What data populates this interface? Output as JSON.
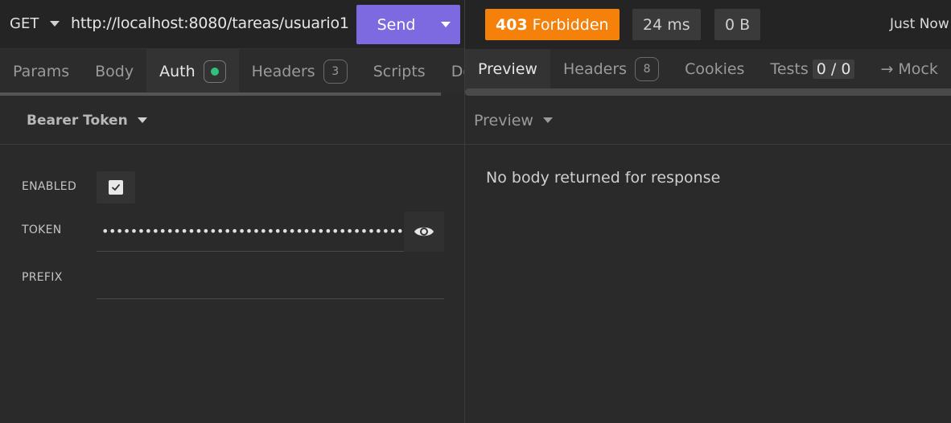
{
  "request": {
    "method": "GET",
    "url": "http://localhost:8080/tareas/usuario1",
    "send_label": "Send"
  },
  "request_tabs": [
    {
      "label": "Params"
    },
    {
      "label": "Body"
    },
    {
      "label": "Auth"
    },
    {
      "label": "Headers",
      "count": "3"
    },
    {
      "label": "Scripts"
    },
    {
      "label": "Docs"
    }
  ],
  "auth": {
    "type_label": "Bearer Token",
    "enabled_label": "ENABLED",
    "enabled": true,
    "token_label": "TOKEN",
    "token_masked": "••••••••••••••••••••••••••••••••••••••••••••••••••",
    "prefix_label": "PREFIX",
    "prefix_value": ""
  },
  "response": {
    "status_code": "403",
    "status_text": "Forbidden",
    "time": "24 ms",
    "size": "0 B",
    "when": "Just Now"
  },
  "response_tabs": [
    {
      "label": "Preview"
    },
    {
      "label": "Headers",
      "count": "8"
    },
    {
      "label": "Cookies"
    },
    {
      "label": "Tests",
      "score": "0 / 0"
    },
    {
      "label": "→ Mock"
    }
  ],
  "preview": {
    "mode_label": "Preview",
    "empty_message": "No body returned for response"
  },
  "colors": {
    "accent": "#7e6ae0",
    "status_error": "#f5800a",
    "auth_active_dot": "#2ec27e"
  }
}
